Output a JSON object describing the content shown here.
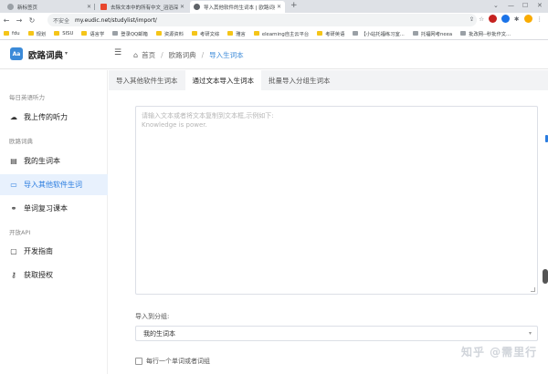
{
  "browser": {
    "tabs": [
      {
        "title": "新标签页",
        "favicon_color": "#9aa0a6"
      },
      {
        "title": "去除文本中的所有中文_滔滔深渊",
        "favicon_color": "#e8452c"
      },
      {
        "title": "导入其他软件的生词本 | 欧路词典",
        "favicon_color": "#5f6368"
      }
    ],
    "new_tab": "+",
    "insecure_label": "不安全",
    "url": "my.eudic.net/studylist/import/",
    "bookmarks": [
      {
        "label": "fdu",
        "icon": "folder"
      },
      {
        "label": "规划",
        "icon": "folder"
      },
      {
        "label": "SISU",
        "icon": "folder"
      },
      {
        "label": "语言学",
        "icon": "folder"
      },
      {
        "label": "登录QQ邮箱",
        "icon": "page"
      },
      {
        "label": "资源资料",
        "icon": "folder"
      },
      {
        "label": "考研文综",
        "icon": "folder"
      },
      {
        "label": "雅言",
        "icon": "folder"
      },
      {
        "label": "elearning自主云平台",
        "icon": "folder"
      },
      {
        "label": "考研英语",
        "icon": "folder"
      },
      {
        "label": "【小站托福练习室...",
        "icon": "page"
      },
      {
        "label": "托福网考neea",
        "icon": "page"
      },
      {
        "label": "批改网--秒批作文...",
        "icon": "page"
      }
    ]
  },
  "app": {
    "logo_abbr": "Aa",
    "name": "欧路词典",
    "breadcrumb": [
      "首页",
      "欧路词典",
      "导入生词本"
    ]
  },
  "sidebar": {
    "sections": [
      {
        "title": "每日英语听力",
        "items": [
          {
            "label": "我上传的听力",
            "icon": "cloud-upload-icon"
          }
        ]
      },
      {
        "title": "欧路词典",
        "items": [
          {
            "label": "我的生词本",
            "icon": "notebook-icon"
          },
          {
            "label": "导入其他软件生词",
            "icon": "folder-icon",
            "active": true
          },
          {
            "label": "单词复习课本",
            "icon": "link-icon"
          }
        ]
      },
      {
        "title": "开放API",
        "items": [
          {
            "label": "开发指南",
            "icon": "chat-icon"
          },
          {
            "label": "获取授权",
            "icon": "key-icon"
          }
        ]
      }
    ]
  },
  "main": {
    "tabs": [
      {
        "label": "导入其他软件生词本",
        "active": false
      },
      {
        "label": "通过文本导入生词本",
        "active": true
      },
      {
        "label": "批量导入分组生词本",
        "active": false
      }
    ],
    "textarea_placeholder_line1": "请输入文本或者将文本复制到文本框,示例如下:",
    "textarea_placeholder_line2": "Knowledge is power.",
    "group_label": "导入到分组:",
    "group_selected": "我的生词本",
    "checkbox_label": "每行一个单词或者词组"
  },
  "watermark": "知乎 @需里行",
  "colors": {
    "accent": "#2b7de0",
    "active_bg": "#e8f1fd",
    "main_bg": "#f2f3f5"
  }
}
